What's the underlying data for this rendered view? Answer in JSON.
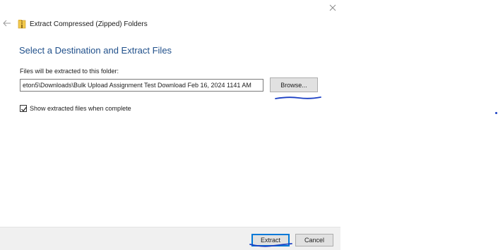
{
  "dialog": {
    "wizard_title": "Extract Compressed (Zipped) Folders",
    "heading": "Select a Destination and Extract Files",
    "folder_label": "Files will be extracted to this folder:",
    "path_value": "eton5\\Downloads\\Bulk Upload Assignment Test Download Feb 16, 2024 1141 AM",
    "browse_label": "Browse...",
    "show_files_label": "Show extracted files when complete",
    "show_files_checked": true
  },
  "footer": {
    "extract_label": "Extract",
    "cancel_label": "Cancel"
  },
  "icons": {
    "close": "close-icon",
    "back": "back-arrow-icon",
    "zip_folder": "zip-folder-icon",
    "checkmark": "checkmark-icon"
  },
  "colors": {
    "heading": "#1f4f8a",
    "annotation_ink": "#1a3fc4",
    "default_button_border": "#0078d7"
  }
}
